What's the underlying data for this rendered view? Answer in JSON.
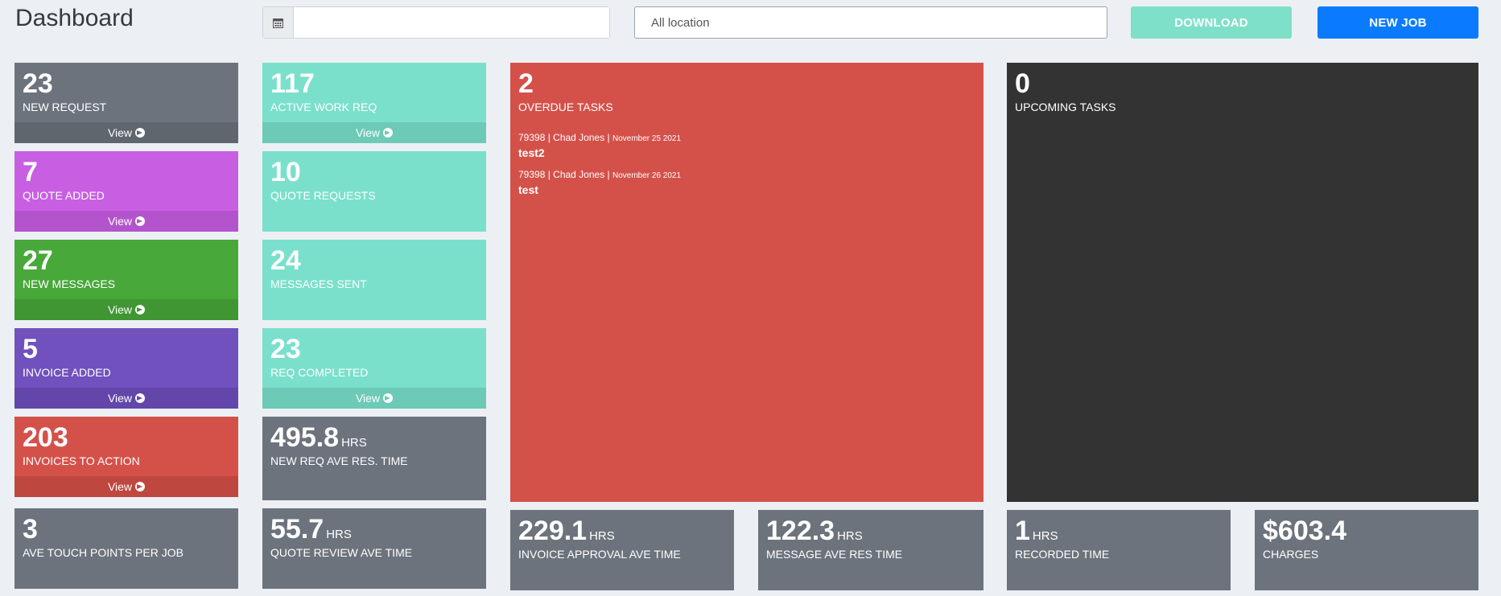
{
  "header": {
    "title": "Dashboard",
    "date_value": "",
    "location_placeholder": "All location",
    "download_label": "DOWNLOAD",
    "new_job_label": "NEW JOB"
  },
  "view_label": "View",
  "col1": [
    {
      "value": "23",
      "label": "NEW REQUEST"
    },
    {
      "value": "7",
      "label": "QUOTE ADDED"
    },
    {
      "value": "27",
      "label": "NEW MESSAGES"
    },
    {
      "value": "5",
      "label": "INVOICE ADDED"
    },
    {
      "value": "203",
      "label": "INVOICES TO ACTION"
    },
    {
      "value": "3",
      "label": "AVE TOUCH POINTS PER JOB"
    }
  ],
  "col2": [
    {
      "value": "117",
      "label": "ACTIVE WORK REQ"
    },
    {
      "value": "10",
      "label": "QUOTE REQUESTS"
    },
    {
      "value": "24",
      "label": "MESSAGES SENT"
    },
    {
      "value": "23",
      "label": "REQ COMPLETED"
    },
    {
      "value": "495.8",
      "unit": "HRS",
      "label": "NEW REQ AVE RES. TIME"
    },
    {
      "value": "55.7",
      "unit": "HRS",
      "label": "QUOTE REVIEW AVE TIME"
    }
  ],
  "overdue": {
    "value": "2",
    "label": "OVERDUE TASKS",
    "tasks": [
      {
        "meta": "79398 | Chad Jones | ",
        "date": "November 25 2021",
        "title": "test2"
      },
      {
        "meta": "79398 | Chad Jones | ",
        "date": "November 26 2021",
        "title": "test"
      }
    ]
  },
  "upcoming": {
    "value": "0",
    "label": "UPCOMING TASKS"
  },
  "bottom": [
    {
      "value": "229.1",
      "unit": "HRS",
      "label": "INVOICE APPROVAL AVE TIME"
    },
    {
      "value": "122.3",
      "unit": "HRS",
      "label": "MESSAGE AVE RES TIME"
    },
    {
      "value": "1",
      "unit": "HRS",
      "label": "RECORDED TIME"
    },
    {
      "value": "$603.4",
      "label": "CHARGES"
    }
  ],
  "colors": {
    "gray": "#6c737c",
    "purple_light": "#c85fe3",
    "green": "#48a83a",
    "purple": "#7151be",
    "red": "#d4514a",
    "teal": "#7ae0cc",
    "dark": "#333333",
    "download": "#7fe0c9",
    "new_job": "#0a7bff"
  }
}
